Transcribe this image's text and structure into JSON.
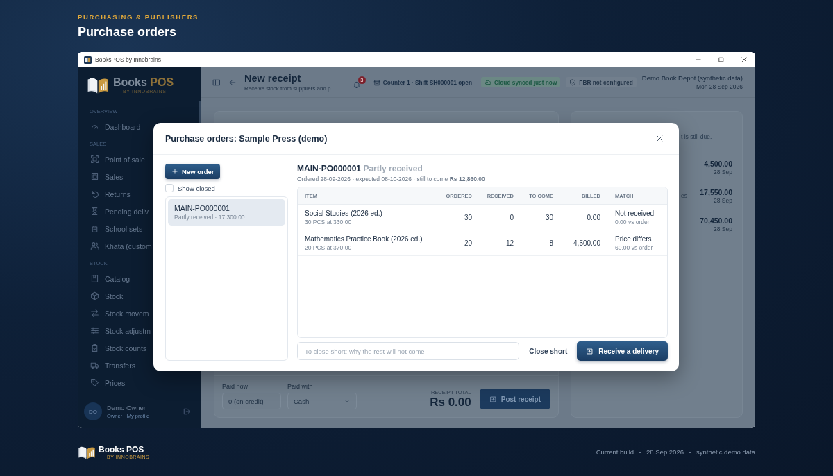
{
  "page_header": {
    "eyebrow": "PURCHASING & PUBLISHERS",
    "title": "Purchase orders"
  },
  "window": {
    "title": "BooksPOS by Innobrains"
  },
  "sidebar": {
    "logo": {
      "name": "Books",
      "accent": "POS",
      "tagline": "BY INNOBRAINS"
    },
    "sections": [
      {
        "label": "OVERVIEW",
        "items": [
          {
            "label": "Dashboard"
          }
        ]
      },
      {
        "label": "SALES",
        "items": [
          {
            "label": "Point of sale"
          },
          {
            "label": "Sales"
          },
          {
            "label": "Returns"
          },
          {
            "label": "Pending deliv"
          },
          {
            "label": "School sets"
          },
          {
            "label": "Khata (custom"
          }
        ]
      },
      {
        "label": "STOCK",
        "items": [
          {
            "label": "Catalog"
          },
          {
            "label": "Stock"
          },
          {
            "label": "Stock movem"
          },
          {
            "label": "Stock adjustm"
          },
          {
            "label": "Stock counts"
          },
          {
            "label": "Transfers"
          },
          {
            "label": "Prices"
          }
        ]
      }
    ],
    "user": {
      "initials": "DO",
      "name": "Demo Owner",
      "role": "Owner · My profile"
    }
  },
  "toolbar": {
    "title": "New receipt",
    "subtitle": "Receive stock from suppliers and p...",
    "notifications": "3",
    "counter": "Counter 1 · Shift SH000001 open",
    "sync": "Cloud synced just now",
    "fbr": "FBR not configured",
    "store": "Demo Book Depot (synthetic data)",
    "date": "Mon 28 Sep 2026"
  },
  "receipt_form": {
    "paid_now": {
      "label": "Paid now",
      "placeholder": "0 (on credit)"
    },
    "paid_with": {
      "label": "Paid with",
      "value": "Cash"
    },
    "total_label": "RECEIPT TOTAL",
    "total": "Rs 0.00",
    "post_button": "Post receipt"
  },
  "recent_receipts": {
    "note": "t is still due.",
    "rows": [
      {
        "amount": "4,500.00",
        "date": "28 Sep"
      },
      {
        "label": "es",
        "amount": "17,550.00",
        "date": "28 Sep"
      },
      {
        "amount": "70,450.00",
        "date": "28 Sep"
      }
    ]
  },
  "dialog": {
    "title": "Purchase orders: Sample Press (demo)",
    "new_order": "New order",
    "show_closed": {
      "label": "Show closed",
      "checked": false
    },
    "orders": [
      {
        "number": "MAIN-PO000001",
        "summary": "Partly received · 17,300.00",
        "selected": true
      }
    ],
    "detail": {
      "number": "MAIN-PO000001",
      "status": "Partly received",
      "meta": "Ordered 28-09-2026 · expected 08-10-2026 · still to come **Rs 12,860.00**"
    },
    "table": {
      "columns": [
        "ITEM",
        "ORDERED",
        "RECEIVED",
        "TO COME",
        "BILLED",
        "MATCH"
      ],
      "rows": [
        {
          "item": "Social Studies (2026 ed.)",
          "detail": "30 PCS at 330.00",
          "ordered": "30",
          "received": "0",
          "to_come": "30",
          "billed": "0.00",
          "match": "Not received",
          "match_detail": "0.00 vs order"
        },
        {
          "item": "Mathematics Practice Book (2026 ed.)",
          "detail": "20 PCS at 370.00",
          "ordered": "20",
          "received": "12",
          "to_come": "8",
          "billed": "4,500.00",
          "match": "Price differs",
          "match_detail": "60.00 vs order"
        }
      ]
    },
    "close_reason": {
      "placeholder": "To close short: why the rest will not come"
    },
    "close_short": "Close short",
    "receive": "Receive a delivery"
  },
  "footer": {
    "logo": {
      "name": "Books POS",
      "tagline": "BY INNOBRAINS"
    },
    "meta": [
      "Current build",
      "28 Sep 2026",
      "synthetic demo data"
    ]
  }
}
